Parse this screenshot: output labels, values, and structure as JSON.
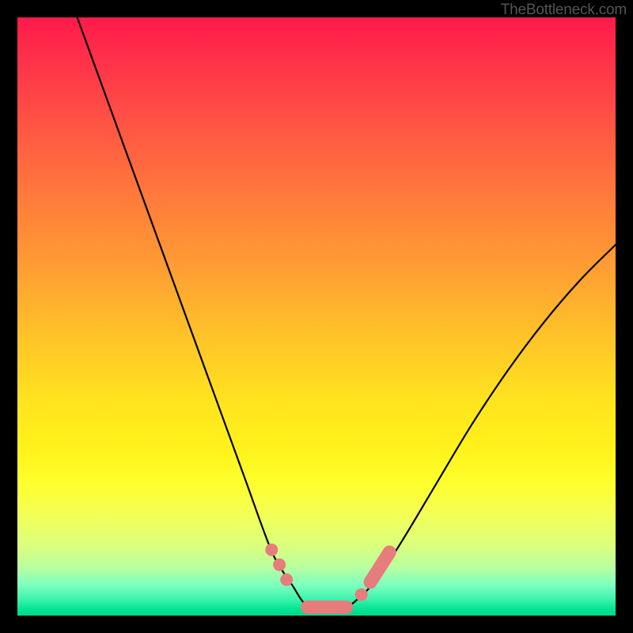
{
  "watermark": "TheBottleneck.com",
  "colors": {
    "frame": "#000000",
    "curve_stroke": "#000000",
    "marker_fill": "#e77c7c",
    "marker_stroke": "#c95b5b"
  },
  "chart_data": {
    "type": "line",
    "title": "",
    "xlabel": "",
    "ylabel": "",
    "xlim": [
      0,
      100
    ],
    "ylim": [
      0,
      100
    ],
    "grid": false,
    "legend": false,
    "series": [
      {
        "name": "bottleneck-curve",
        "x": [
          10,
          14,
          18,
          22,
          26,
          30,
          34,
          38,
          42,
          44,
          46,
          48,
          50,
          52,
          54,
          56,
          60,
          64,
          70,
          76,
          82,
          88,
          94,
          100
        ],
        "y": [
          100,
          89,
          78,
          67,
          56,
          45,
          34,
          23,
          12,
          8,
          5,
          2,
          1,
          1,
          1,
          2,
          6,
          12,
          22,
          32,
          41,
          49,
          56,
          62
        ]
      }
    ],
    "markers": [
      {
        "kind": "point",
        "x": 42.5,
        "y": 11
      },
      {
        "kind": "point",
        "x": 43.8,
        "y": 8.5
      },
      {
        "kind": "point",
        "x": 45.0,
        "y": 6
      },
      {
        "kind": "capsule",
        "x1": 48.5,
        "y1": 1.4,
        "x2": 55.0,
        "y2": 1.4
      },
      {
        "kind": "point",
        "x": 57.5,
        "y": 3.5
      },
      {
        "kind": "capsule",
        "x1": 59.0,
        "y1": 5.6,
        "x2": 62.2,
        "y2": 10.6
      }
    ]
  }
}
